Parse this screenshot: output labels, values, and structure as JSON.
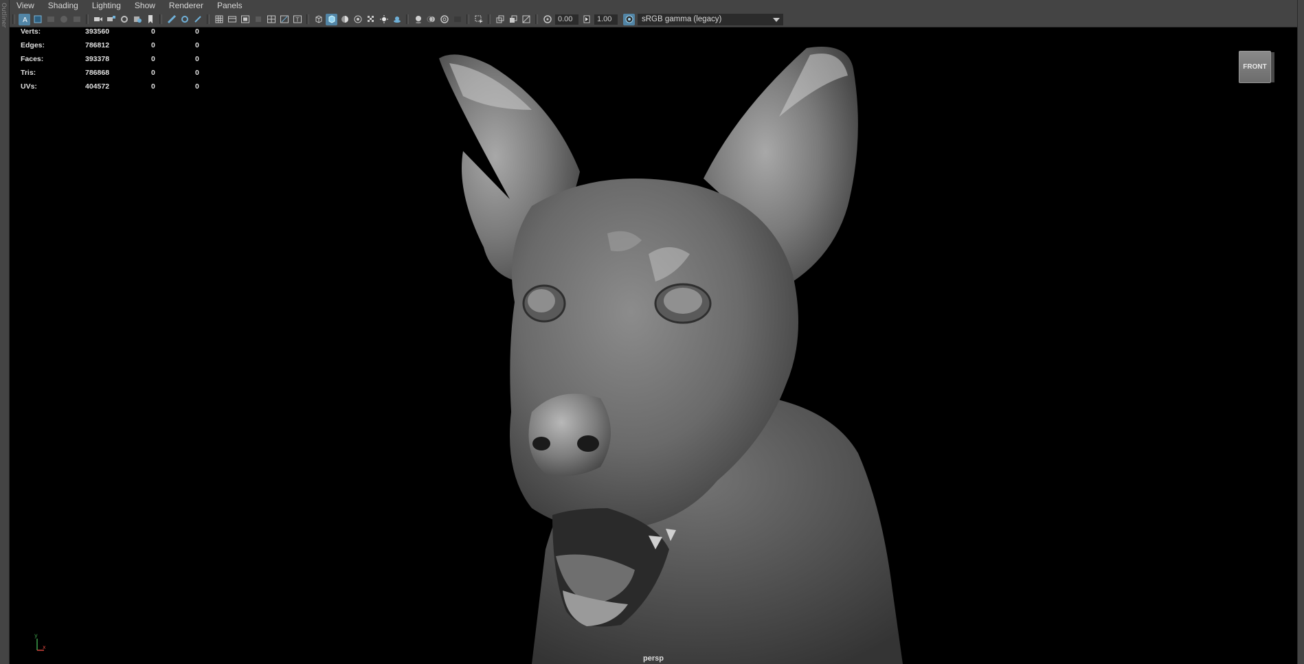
{
  "menubar": {
    "items": [
      "View",
      "Shading",
      "Lighting",
      "Show",
      "Renderer",
      "Panels"
    ]
  },
  "toolbar": {
    "exposure_value": "0.00",
    "gamma_value": "1.00",
    "color_space": "sRGB gamma (legacy)",
    "accent_color": "#5285a6"
  },
  "hud": {
    "rows": [
      {
        "label": "Verts:",
        "v1": "393560",
        "v2": "0",
        "v3": "0"
      },
      {
        "label": "Edges:",
        "v1": "786812",
        "v2": "0",
        "v3": "0"
      },
      {
        "label": "Faces:",
        "v1": "393378",
        "v2": "0",
        "v3": "0"
      },
      {
        "label": "Tris:",
        "v1": "786868",
        "v2": "0",
        "v3": "0"
      },
      {
        "label": "UVs:",
        "v1": "404572",
        "v2": "0",
        "v3": "0"
      }
    ]
  },
  "viewport": {
    "camera": "persp",
    "viewcube_face": "FRONT",
    "axis_y": "y",
    "axis_x": "x",
    "model": "dog-head-sculpt"
  },
  "side_panel": {
    "label": "Outliner"
  }
}
